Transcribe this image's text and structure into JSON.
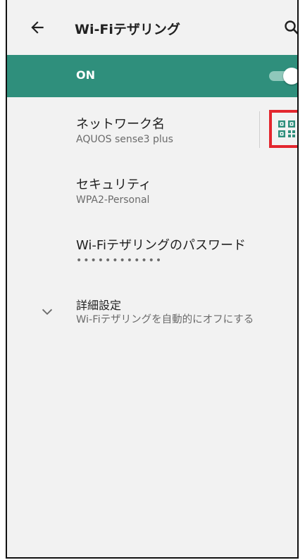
{
  "appbar": {
    "title": "Wi-Fiテザリング",
    "back_icon": "arrow-left-icon",
    "search_icon": "search-icon"
  },
  "toggle_row": {
    "label": "ON",
    "state": true
  },
  "settings": {
    "network_name": {
      "title": "ネットワーク名",
      "value": "AQUOS sense3 plus",
      "action_icon": "qr-code-icon"
    },
    "security": {
      "title": "セキュリティ",
      "value": "WPA2-Personal"
    },
    "password": {
      "title": "Wi-Fiテザリングのパスワード",
      "value": "••••••••••••"
    },
    "advanced": {
      "title": "詳細設定",
      "value": "Wi-Fiテザリングを自動的にオフにする",
      "icon": "chevron-down-icon"
    }
  },
  "colors": {
    "accent": "#2f8f7c",
    "highlight_box": "#e3262e",
    "background": "#f2f2f2"
  }
}
